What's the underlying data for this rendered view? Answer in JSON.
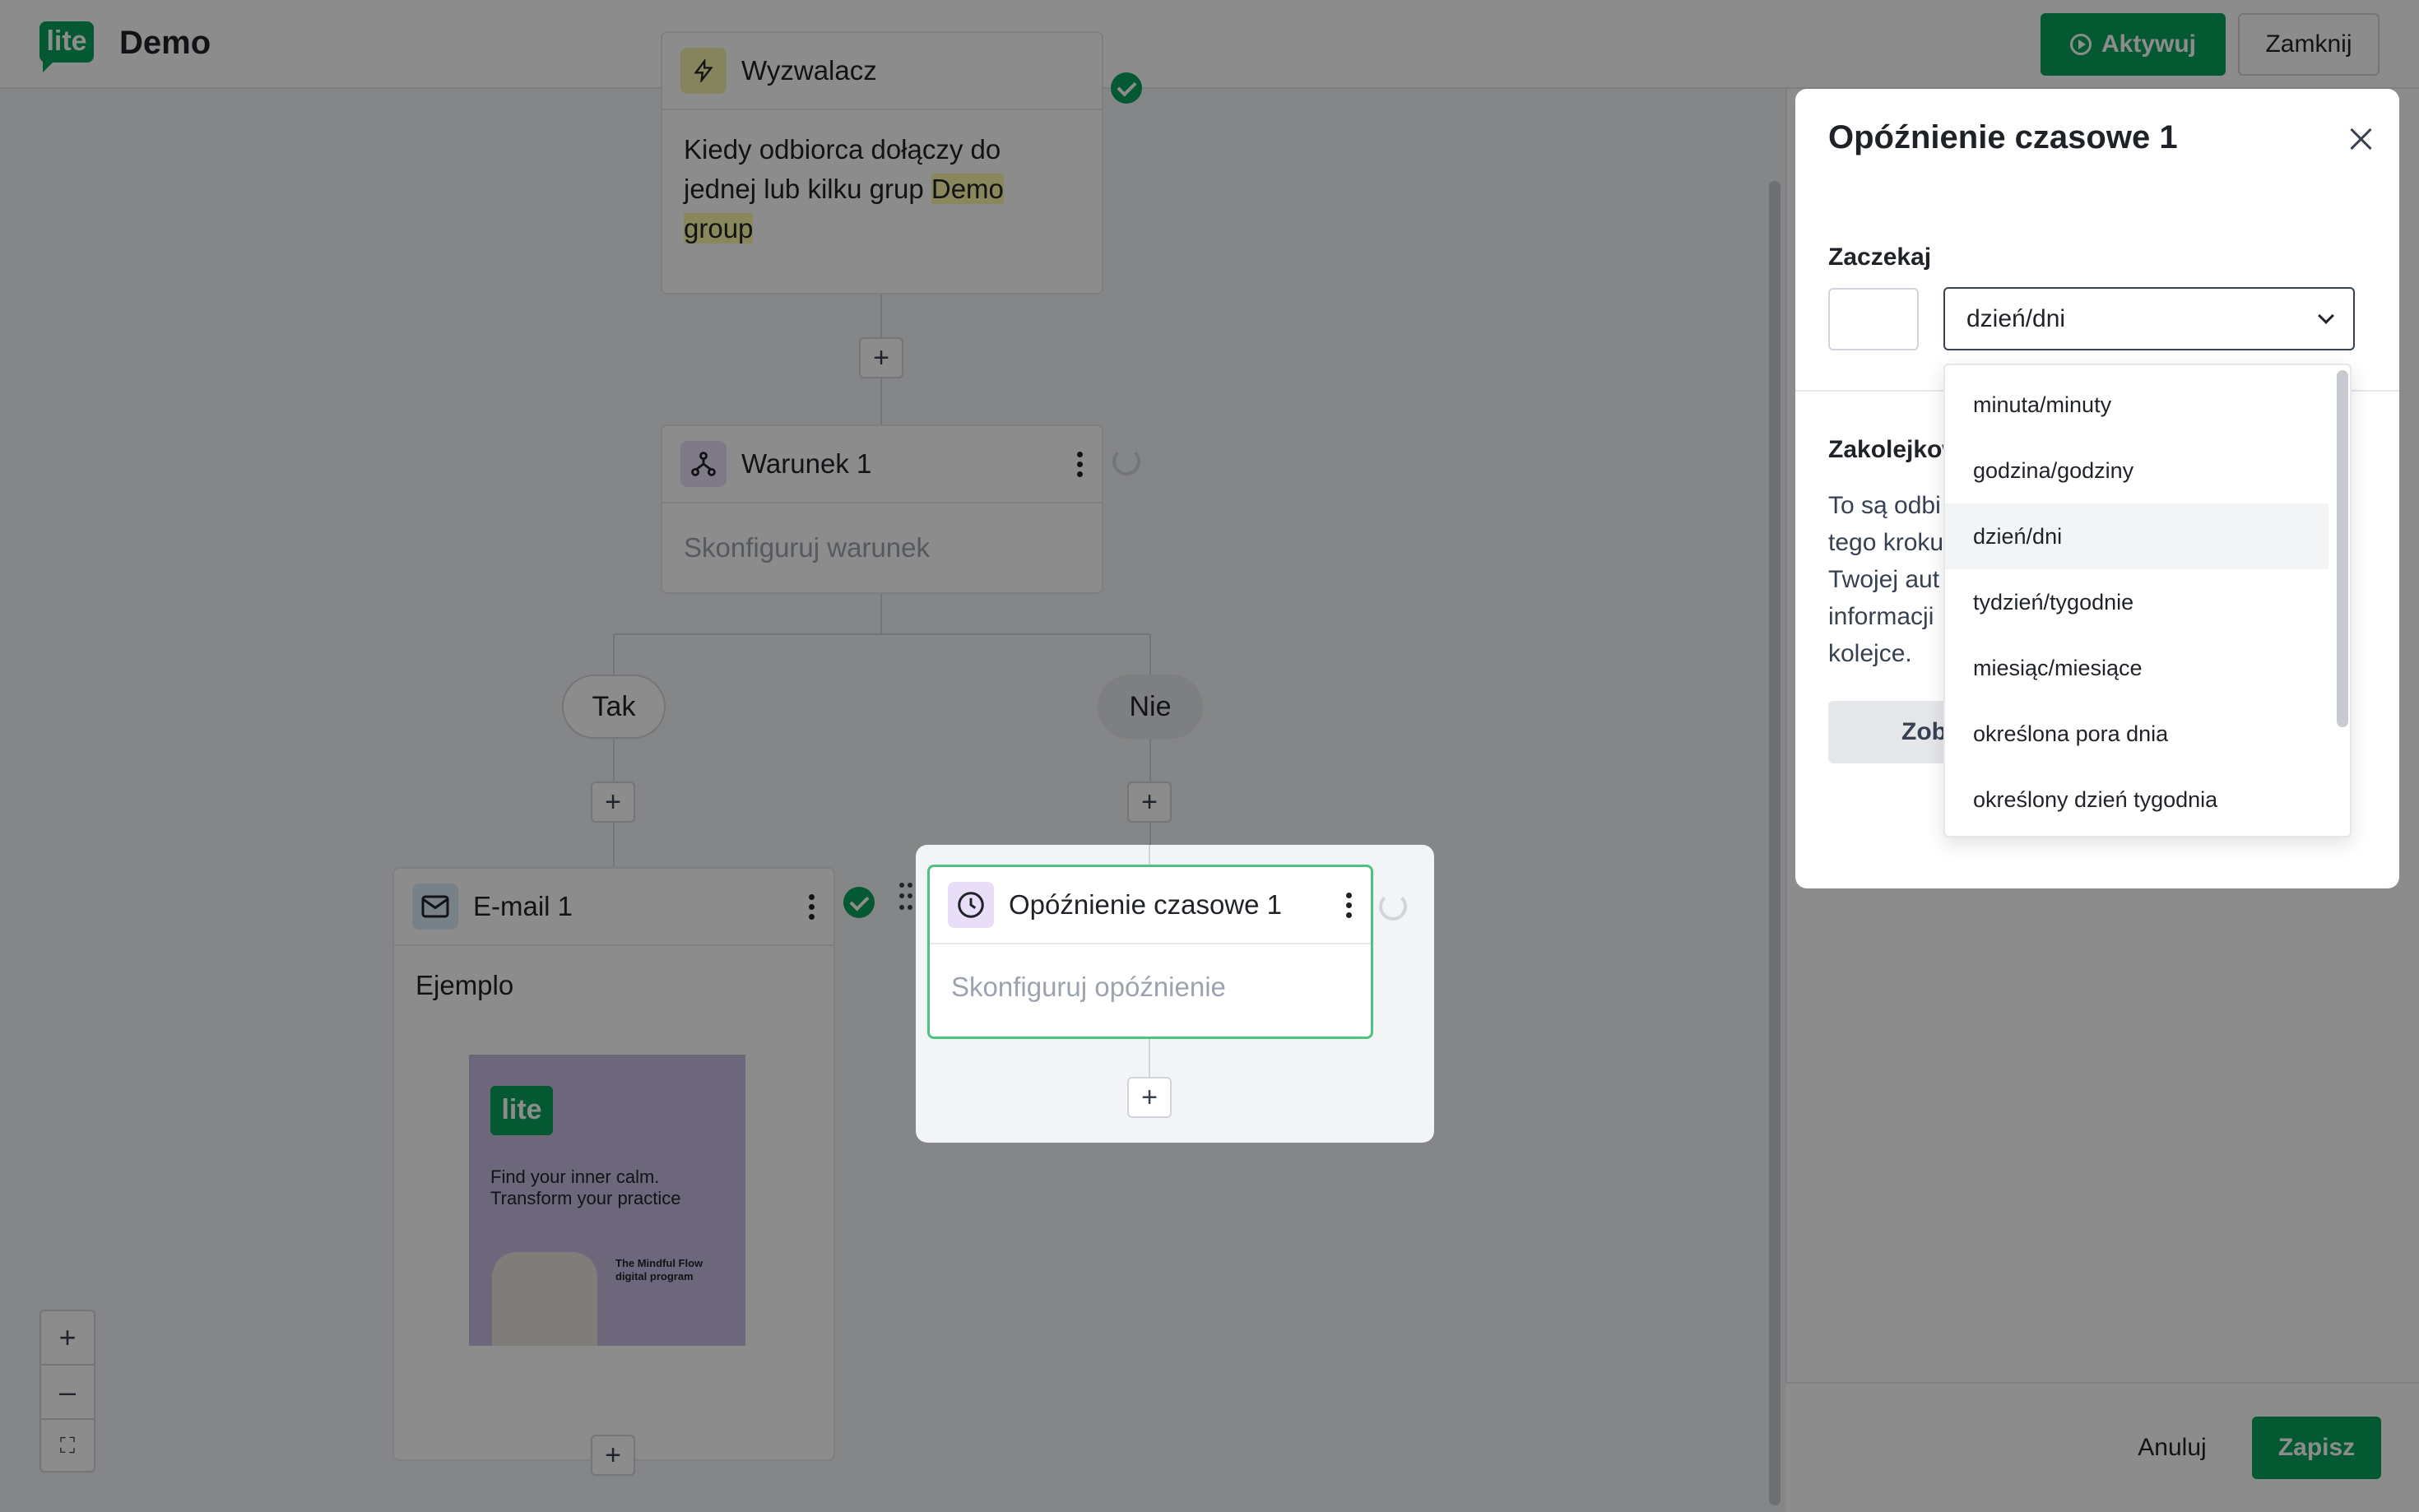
{
  "app": {
    "logo_text": "lite",
    "title": "Demo"
  },
  "header": {
    "activate_label": "Aktywuj",
    "close_label": "Zamknij"
  },
  "colors": {
    "accent": "#09a35b",
    "highlight": "#fdf6a8",
    "trigger_icon_bg": "#f3f0a8",
    "condition_icon_bg": "#e9def7",
    "email_icon_bg": "#dbe9f7"
  },
  "workflow": {
    "trigger": {
      "title": "Wyzwalacz",
      "body_prefix": "Kiedy odbiorca dołączy do jednej lub kilku grup ",
      "group": "Demo group",
      "icon": "bolt-icon"
    },
    "condition": {
      "title": "Warunek 1",
      "placeholder": "Skonfiguruj warunek",
      "icon": "branch-icon"
    },
    "branch_yes": "Tak",
    "branch_no": "Nie",
    "email": {
      "title": "E-mail 1",
      "body": "Ejemplo",
      "icon": "envelope-icon",
      "thumbnail": {
        "logo": "lite",
        "headline_1": "Find your inner calm.",
        "headline_2": "Transform your practice",
        "program": "The Mindful Flow digital program"
      }
    },
    "delay": {
      "title": "Opóźnienie czasowe 1",
      "placeholder": "Skonfiguruj opóźnienie",
      "icon": "clock-icon"
    }
  },
  "zoom": {
    "in": "+",
    "out": "–",
    "fit": "⛶"
  },
  "modal": {
    "title": "Opóźnienie czasowe 1",
    "wait_label": "Zaczekaj",
    "wait_value": "",
    "unit_selected": "dzień/dni",
    "queue_title": "Zakolejkow",
    "queue_text_lines": [
      "To są odbi",
      "tego kroku",
      "Twojej aut",
      "informacji",
      "kolejce."
    ],
    "queue_button": "Zob"
  },
  "dropdown": {
    "options": [
      "minuta/minuty",
      "godzina/godziny",
      "dzień/dni",
      "tydzień/tygodnie",
      "miesiąc/miesiące",
      "określona pora dnia",
      "określony dzień tygodnia"
    ],
    "selected_index": 2
  },
  "footer": {
    "cancel_label": "Anuluj",
    "save_label": "Zapisz"
  }
}
